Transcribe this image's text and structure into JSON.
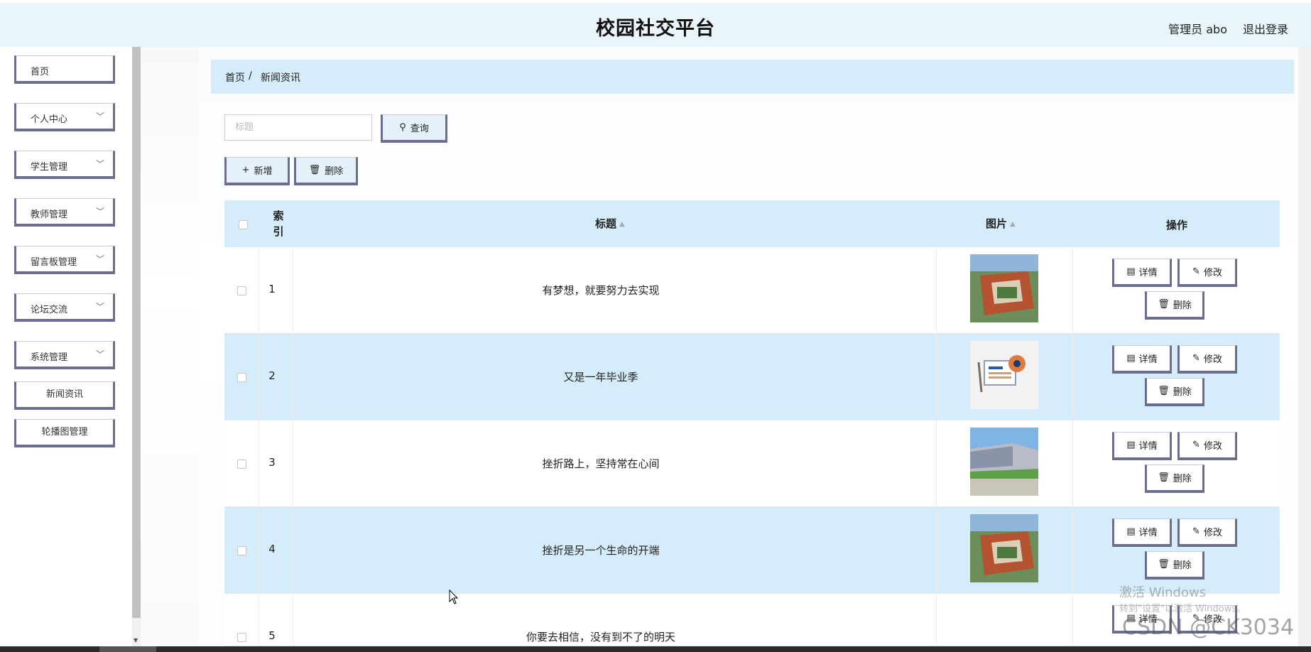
{
  "header": {
    "title": "校园社交平台",
    "user": "管理员 abo",
    "logout": "退出登录"
  },
  "sidebar": {
    "items": [
      {
        "label": "首页",
        "has_chevron": false
      },
      {
        "label": "个人中心",
        "has_chevron": true
      },
      {
        "label": "学生管理",
        "has_chevron": true
      },
      {
        "label": "教师管理",
        "has_chevron": true
      },
      {
        "label": "留言板管理",
        "has_chevron": true
      },
      {
        "label": "论坛交流",
        "has_chevron": true
      },
      {
        "label": "系统管理",
        "has_chevron": true
      }
    ],
    "sub_items": [
      {
        "label": "新闻资讯"
      },
      {
        "label": "轮播图管理"
      }
    ]
  },
  "breadcrumb": {
    "home": "首页",
    "separator": "/",
    "current": "新闻资讯"
  },
  "search": {
    "placeholder": "标题",
    "value": "",
    "button_label": "查询"
  },
  "toolbar": {
    "add_label": "新增",
    "delete_label": "删除"
  },
  "table": {
    "headers": {
      "index": "索\n引",
      "title": "标题",
      "image": "图片",
      "actions": "操作"
    },
    "rows": [
      {
        "index": "1",
        "title": "有梦想，就要努力去实现",
        "image": "campus-aerial-photo"
      },
      {
        "index": "2",
        "title": "又是一年毕业季",
        "image": "news-illustration"
      },
      {
        "index": "3",
        "title": "挫折路上，坚持常在心间",
        "image": "campus-building-photo"
      },
      {
        "index": "4",
        "title": "挫折是另一个生命的开端",
        "image": "campus-aerial-photo"
      },
      {
        "index": "5",
        "title": "你要去相信，没有到不了的明天",
        "image": ""
      }
    ],
    "action_labels": {
      "detail": "详情",
      "edit": "修改",
      "delete": "删除"
    }
  },
  "watermark": {
    "line1": "激活 Windows",
    "line2": "转到\"设置\"以激活 Windows。",
    "line3": "CSDN @CK3034"
  },
  "colors": {
    "accent_border": "#6b6d8f",
    "row_highlight": "#d5ecfb",
    "header_bg": "#eaf4fb"
  }
}
